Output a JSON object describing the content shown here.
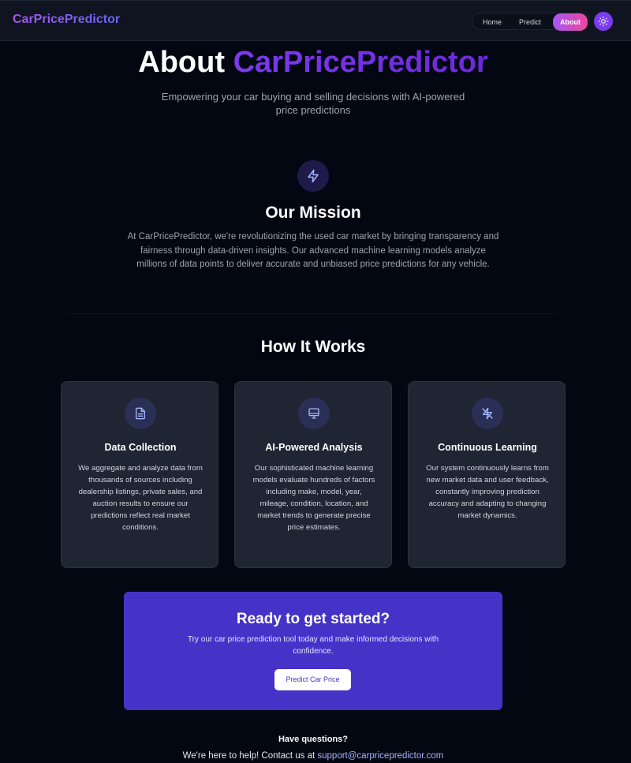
{
  "nav": {
    "brand": "CarPricePredictor",
    "links": [
      "Home",
      "Predict",
      "About"
    ],
    "active": "About",
    "theme_icon": "sun-icon"
  },
  "hero": {
    "title_prefix": "About",
    "title_accent": "CarPricePredictor",
    "subtitle": "Empowering your car buying and selling decisions with AI-powered price predictions"
  },
  "mission": {
    "icon": "lightning-icon",
    "title": "Our Mission",
    "text": "At CarPricePredictor, we're revolutionizing the used car market by bringing transparency and fairness through data-driven insights. Our advanced machine learning models analyze millions of data points to deliver accurate and unbiased price predictions for any vehicle."
  },
  "how_it_works": {
    "title": "How It Works",
    "cards": [
      {
        "icon": "document-icon",
        "title": "Data Collection",
        "text": "We aggregate and analyze data from thousands of sources including dealership listings, private sales, and auction results to ensure our predictions reflect real market conditions."
      },
      {
        "icon": "monitor-icon",
        "title": "AI-Powered Analysis",
        "text": "Our sophisticated machine learning models evaluate hundreds of factors including make, model, year, mileage, condition, location, and market trends to generate precise price estimates."
      },
      {
        "icon": "zap-off-icon",
        "title": "Continuous Learning",
        "text": "Our system continuously learns from new market data and user feedback, constantly improving prediction accuracy and adapting to changing market dynamics."
      }
    ]
  },
  "cta": {
    "title": "Ready to get started?",
    "text": "Try our car price prediction tool today and make informed decisions with confidence.",
    "button": "Predict Car Price"
  },
  "contact": {
    "title": "Have questions?",
    "text": "We're here to help! Contact us at",
    "email": "support@carpricepredictor.com"
  },
  "colors": {
    "background": "#030712",
    "accent": "#7c3aed",
    "cta_background": "#4533c8",
    "card_background": "#1f2533"
  }
}
